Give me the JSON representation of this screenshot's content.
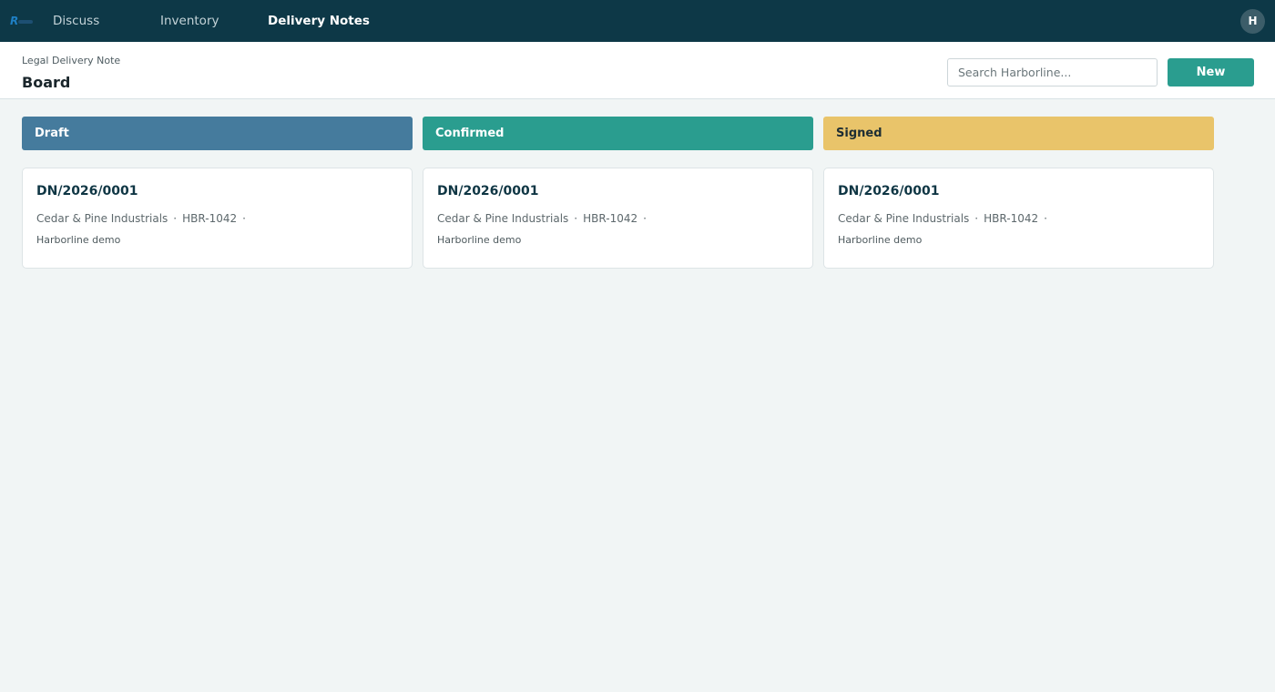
{
  "nav": {
    "items": [
      {
        "label": "Discuss",
        "active": false
      },
      {
        "label": "Inventory",
        "active": false
      },
      {
        "label": "Delivery Notes",
        "active": true
      }
    ],
    "user_initial": "H",
    "logo_icon": "logo-icon"
  },
  "header": {
    "breadcrumb": "Legal Delivery Note",
    "title": "Board",
    "search_placeholder": "Search Harborline...",
    "new_label": "New"
  },
  "columns": [
    {
      "title": "Draft",
      "color": "#457b9d",
      "text_color": "#ffffff",
      "cards": [
        {
          "ref": "DN/2026/0001",
          "partner": "Cedar & Pine Industrials",
          "code": "HBR-1042",
          "company": "Harborline demo"
        }
      ]
    },
    {
      "title": "Confirmed",
      "color": "#2a9d8f",
      "text_color": "#ffffff",
      "cards": [
        {
          "ref": "DN/2026/0001",
          "partner": "Cedar & Pine Industrials",
          "code": "HBR-1042",
          "company": "Harborline demo"
        }
      ]
    },
    {
      "title": "Signed",
      "color": "#e9c46a",
      "text_color": "#1d2d33",
      "cards": [
        {
          "ref": "DN/2026/0001",
          "partner": "Cedar & Pine Industrials",
          "code": "HBR-1042",
          "company": "Harborline demo"
        }
      ]
    }
  ],
  "separator": "·"
}
